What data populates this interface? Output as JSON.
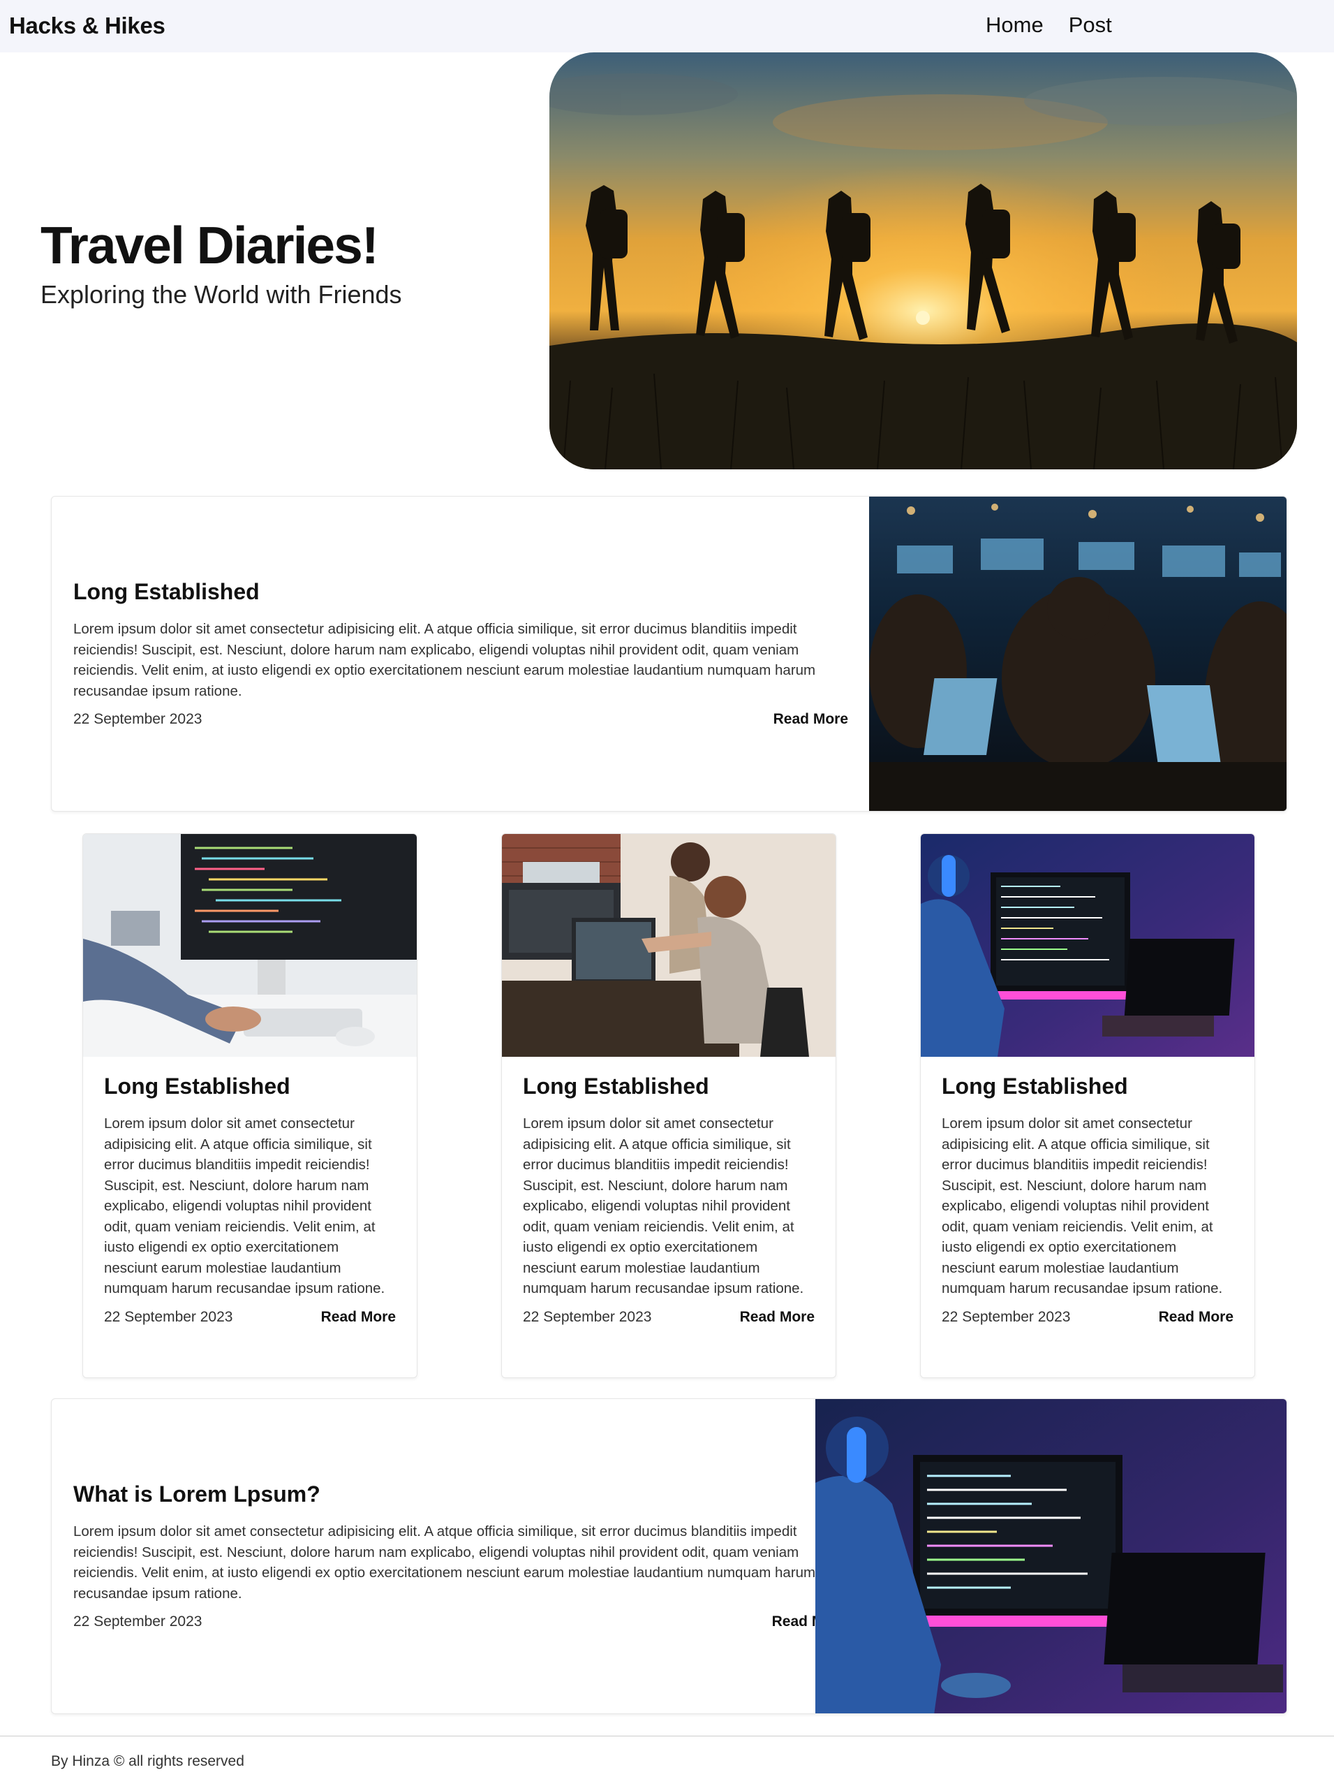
{
  "nav": {
    "brand": "Hacks & Hikes",
    "links": [
      "Home",
      "Post"
    ]
  },
  "hero": {
    "title": "Travel Diaries!",
    "subtitle": "Exploring the World with Friends"
  },
  "featured": {
    "title": "Long Established",
    "text": "Lorem ipsum dolor sit amet consectetur adipisicing elit. A atque officia similique, sit error ducimus blanditiis impedit reiciendis! Suscipit, est. Nesciunt, dolore harum nam explicabo, eligendi voluptas nihil provident odit, quam veniam reiciendis. Velit enim, at iusto eligendi ex optio exercitationem nesciunt earum molestiae laudantium numquam harum recusandae ipsum ratione.",
    "date": "22 September 2023",
    "read_more": "Read More"
  },
  "cards": [
    {
      "title": "Long Established",
      "text": "Lorem ipsum dolor sit amet consectetur adipisicing elit. A atque officia similique, sit error ducimus blanditiis impedit reiciendis! Suscipit, est. Nesciunt, dolore harum nam explicabo, eligendi voluptas nihil provident odit, quam veniam reiciendis. Velit enim, at iusto eligendi ex optio exercitationem nesciunt earum molestiae laudantium numquam harum recusandae ipsum ratione.",
      "date": "22 September 2023",
      "read_more": "Read More"
    },
    {
      "title": "Long Established",
      "text": "Lorem ipsum dolor sit amet consectetur adipisicing elit. A atque officia similique, sit error ducimus blanditiis impedit reiciendis! Suscipit, est. Nesciunt, dolore harum nam explicabo, eligendi voluptas nihil provident odit, quam veniam reiciendis. Velit enim, at iusto eligendi ex optio exercitationem nesciunt earum molestiae laudantium numquam harum recusandae ipsum ratione.",
      "date": "22 September 2023",
      "read_more": "Read More"
    },
    {
      "title": "Long Established",
      "text": "Lorem ipsum dolor sit amet consectetur adipisicing elit. A atque officia similique, sit error ducimus blanditiis impedit reiciendis! Suscipit, est. Nesciunt, dolore harum nam explicabo, eligendi voluptas nihil provident odit, quam veniam reiciendis. Velit enim, at iusto eligendi ex optio exercitationem nesciunt earum molestiae laudantium numquam harum recusandae ipsum ratione.",
      "date": "22 September 2023",
      "read_more": "Read More"
    }
  ],
  "bottom": {
    "title": "What is Lorem Lpsum?",
    "text": "Lorem ipsum dolor sit amet consectetur adipisicing elit. A atque officia similique, sit error ducimus blanditiis impedit reiciendis! Suscipit, est. Nesciunt, dolore harum nam explicabo, eligendi voluptas nihil provident odit, quam veniam reiciendis. Velit enim, at iusto eligendi ex optio exercitationem nesciunt earum molestiae laudantium numquam harum recusandae ipsum ratione.",
    "date": "22 September 2023",
    "read_more": "Read More"
  },
  "footer": {
    "text": "By Hinza © all rights reserved"
  }
}
